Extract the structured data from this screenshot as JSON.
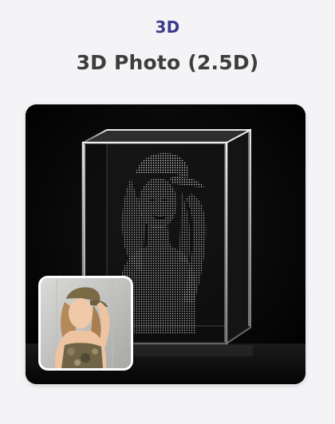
{
  "card": {
    "category": "3D",
    "title": "3D Photo (2.5D)"
  },
  "product_image": {
    "icon": "crystal-engraving-image"
  },
  "thumbnail": {
    "icon": "original-photo-thumbnail"
  },
  "colors": {
    "category": "#3c3b8b",
    "title": "#3d3d3d",
    "background": "#f4f4f6"
  }
}
